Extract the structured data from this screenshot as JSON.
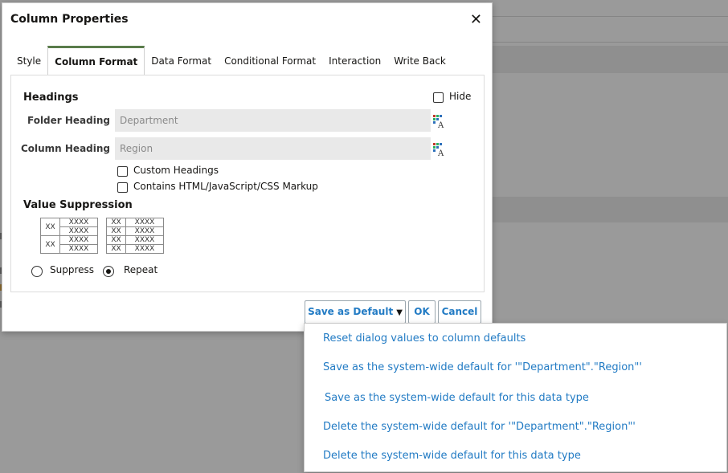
{
  "dialog": {
    "title": "Column Properties",
    "close_symbol": "✕",
    "tabs": [
      "Style",
      "Column Format",
      "Data Format",
      "Conditional Format",
      "Interaction",
      "Write Back"
    ],
    "active_tab": "Column Format"
  },
  "headings": {
    "section_title": "Headings",
    "hide_label": "Hide",
    "folder_heading_label": "Folder Heading",
    "folder_heading_value": "Department",
    "column_heading_label": "Column Heading",
    "column_heading_value": "Region",
    "custom_headings_label": "Custom Headings",
    "html_markup_label": "Contains HTML/JavaScript/CSS Markup"
  },
  "value_suppression": {
    "section_title": "Value Suppression",
    "sample_outer": "XX",
    "sample_inner": "XXXX",
    "suppress_label": "Suppress",
    "repeat_label": "Repeat",
    "selected": "Repeat"
  },
  "buttons": {
    "save_as_default": "Save as Default",
    "ok": "OK",
    "cancel": "Cancel"
  },
  "menu": {
    "items": [
      "Reset dialog values to column defaults",
      "Save as the system-wide default for '\"Department\".\"Region\"'",
      "Save as the system-wide default for this data type",
      "Delete the system-wide default for '\"Department\".\"Region\"'",
      "Delete the system-wide default for this data type"
    ]
  },
  "colors": {
    "link_blue": "#227bc4",
    "active_tab_accent": "#5a7c4b",
    "overlay": "#9a9a9a"
  },
  "icons": {
    "format_heading": "format-heading-icon",
    "close": "close-icon",
    "dropdown": "chevron-down-icon"
  }
}
